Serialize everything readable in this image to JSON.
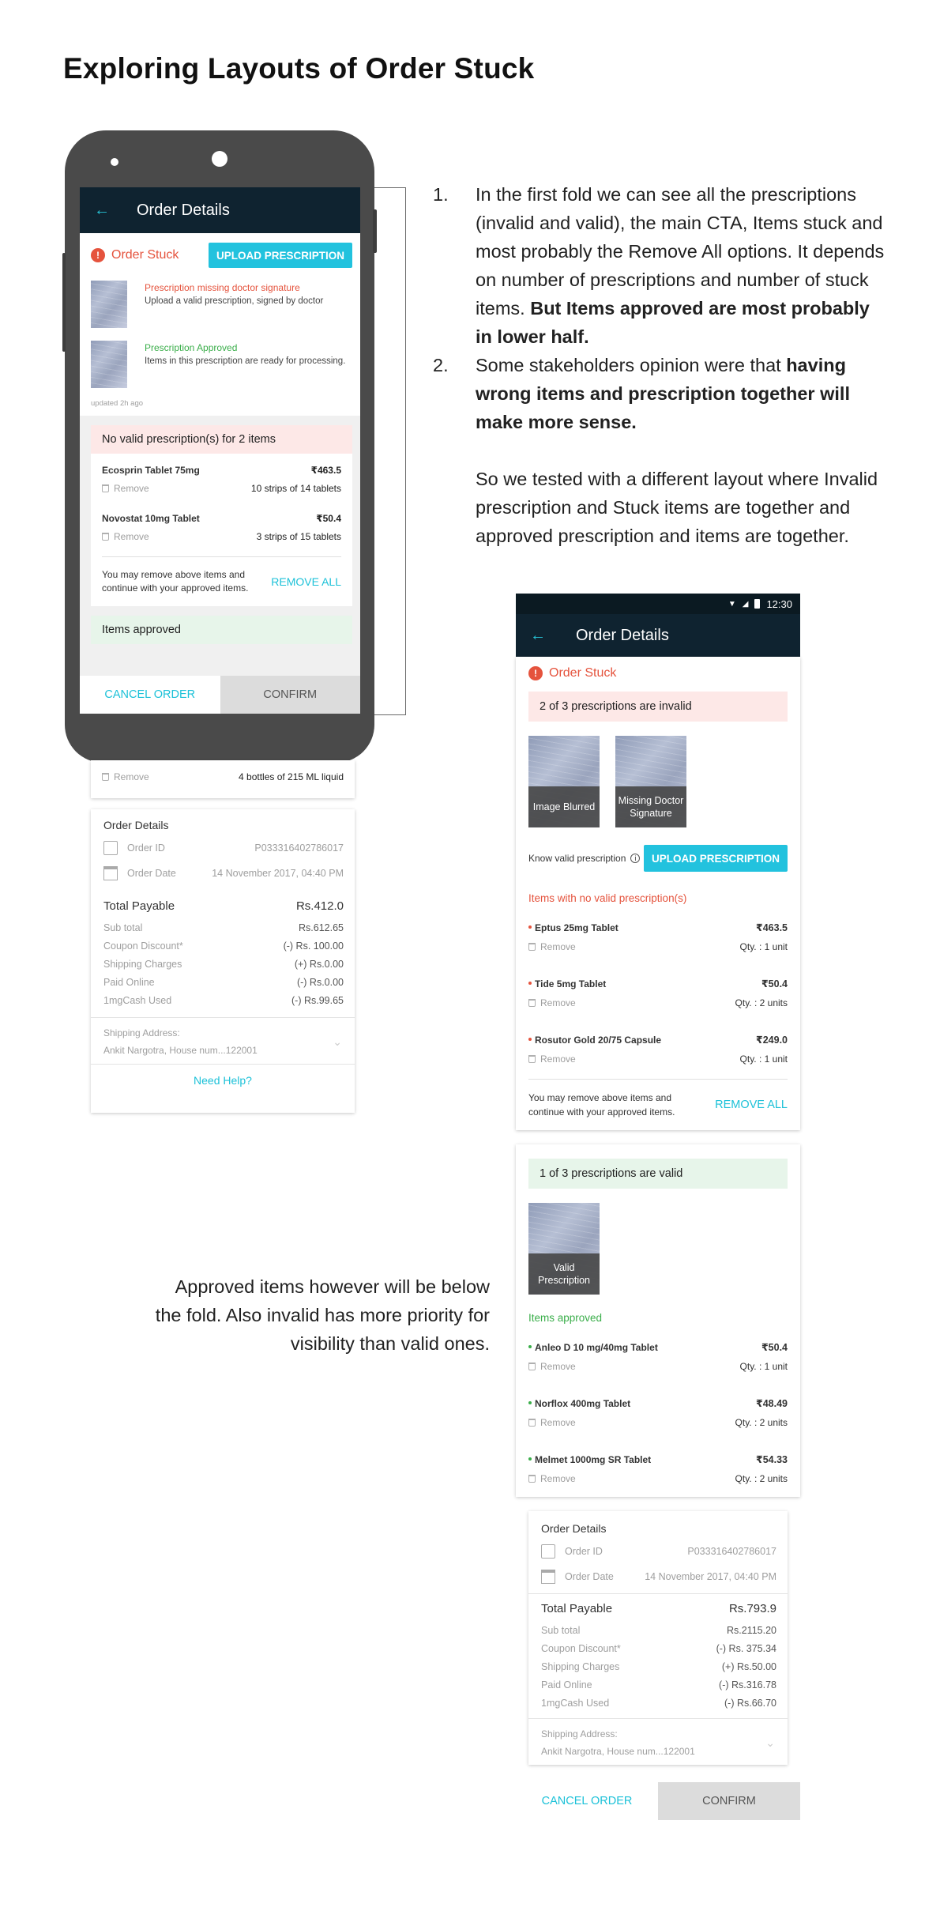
{
  "page_title": "Exploring Layouts of Order Stuck",
  "notes": {
    "item1_num": "1.",
    "item1_text": "In the first fold we can see all the prescriptions (invalid and valid), the main CTA, Items stuck and most probably the Remove All options. It depends on number of prescriptions and number of stuck items. ",
    "item1_bold": "But Items approved are most probably in lower half.",
    "item2_num": "2.",
    "item2_text": "Some stakeholders opinion were that ",
    "item2_bold": "having wrong items and prescription together will make more sense.",
    "para": "So we tested with a different layout where Invalid prescription and Stuck items are together and approved prescription and items are together."
  },
  "fold_note": "Approved items however will be below the fold. Also invalid has more priority for visibility than valid ones.",
  "left_mock": {
    "app_title": "Order Details",
    "back_glyph": "←",
    "order_stuck": "Order Stuck",
    "warn_glyph": "!",
    "upload_btn": "UPLOAD PRESCRIPTION",
    "prescriptions": [
      {
        "title": "Prescription missing doctor signature",
        "desc": "Upload a valid prescription, signed by doctor",
        "status": "invalid"
      },
      {
        "title": "Prescription Approved",
        "desc": "Items in this prescription are ready for processing.",
        "status": "valid"
      }
    ],
    "updated": "updated 2h ago",
    "invalid_banner": "No valid prescription(s) for 2 items",
    "items": [
      {
        "name": "Ecosprin Tablet 75mg",
        "price": "₹463.5",
        "qty": "10 strips of 14 tablets"
      },
      {
        "name": "Novostat 10mg Tablet",
        "price": "₹50.4",
        "qty": "3 strips of 15 tablets"
      }
    ],
    "remove_label": "Remove",
    "remove_note": "You may remove above items and continue with your approved items.",
    "remove_all": "REMOVE ALL",
    "approved_banner": "Items approved",
    "cancel": "CANCEL ORDER",
    "confirm": "CONFIRM",
    "below_fold_qty": "4 bottles of 215 ML liquid",
    "details": {
      "label": "Order Details",
      "order_id_label": "Order ID",
      "order_id": "P033316402786017",
      "order_date_label": "Order Date",
      "order_date": "14 November 2017, 04:40 PM",
      "total_label": "Total Payable",
      "total": "Rs.412.0",
      "rows": [
        {
          "label": "Sub total",
          "value": "Rs.612.65"
        },
        {
          "label": "Coupon Discount*",
          "value": "(-) Rs. 100.00"
        },
        {
          "label": "Shipping Charges",
          "value": "(+) Rs.0.00"
        },
        {
          "label": "Paid Online",
          "value": "(-) Rs.0.00"
        },
        {
          "label": "1mgCash Used",
          "value": "(-) Rs.99.65"
        }
      ],
      "ship_label": "Shipping Address:",
      "ship_value": "Ankit Nargotra, House num...122001",
      "help": "Need Help?"
    }
  },
  "right_mock": {
    "time": "12:30",
    "app_title": "Order Details",
    "back_glyph": "←",
    "order_stuck": "Order Stuck",
    "warn_glyph": "!",
    "invalid_banner": "2 of 3 prescriptions are invalid",
    "invalid_thumbs": [
      "Image Blurred",
      "Missing Doctor Signature"
    ],
    "know_valid": "Know valid prescription",
    "info_glyph": "i",
    "upload_btn": "UPLOAD PRESCRIPTION",
    "invalid_items_label": "Items with no valid prescription(s)",
    "invalid_items": [
      {
        "name": "Eptus 25mg Tablet",
        "price": "₹463.5",
        "qty": "Qty. :   1 unit"
      },
      {
        "name": "Tide 5mg Tablet",
        "price": "₹50.4",
        "qty": "Qty. :  2 units"
      },
      {
        "name": "Rosutor Gold 20/75 Capsule",
        "price": "₹249.0",
        "qty": "Qty. :   1 unit"
      }
    ],
    "remove_label": "Remove",
    "remove_note": "You may remove above items and continue with your approved items.",
    "remove_all": "REMOVE ALL",
    "valid_banner": "1 of 3 prescriptions are valid",
    "valid_thumb": "Valid Prescription",
    "approved_label": "Items approved",
    "approved_items": [
      {
        "name": "Anleo D 10 mg/40mg Tablet",
        "price": "₹50.4",
        "qty": "Qty. :   1 unit"
      },
      {
        "name": "Norflox 400mg Tablet",
        "price": "₹48.49",
        "qty": "Qty. :  2 units"
      },
      {
        "name": "Melmet 1000mg SR Tablet",
        "price": "₹54.33",
        "qty": "Qty. :  2 units"
      }
    ],
    "details": {
      "label": "Order Details",
      "order_id_label": "Order ID",
      "order_id": "P033316402786017",
      "order_date_label": "Order Date",
      "order_date": "14 November 2017, 04:40 PM",
      "total_label": "Total Payable",
      "total": "Rs.793.9",
      "rows": [
        {
          "label": "Sub total",
          "value": "Rs.2115.20"
        },
        {
          "label": "Coupon Discount*",
          "value": "(-) Rs. 375.34"
        },
        {
          "label": "Shipping Charges",
          "value": "(+) Rs.50.00"
        },
        {
          "label": "Paid Online",
          "value": "(-) Rs.316.78"
        },
        {
          "label": "1mgCash Used",
          "value": "(-) Rs.66.70"
        }
      ],
      "ship_label": "Shipping Address:",
      "ship_value": "Ankit Nargotra, House num...122001"
    },
    "cancel": "CANCEL ORDER",
    "confirm": "CONFIRM"
  },
  "colors": {
    "appbar": "#0f2330",
    "accent": "#22c2de",
    "error": "#e5533d",
    "success": "#3aae4a",
    "phone_body": "#4a4a4a"
  }
}
